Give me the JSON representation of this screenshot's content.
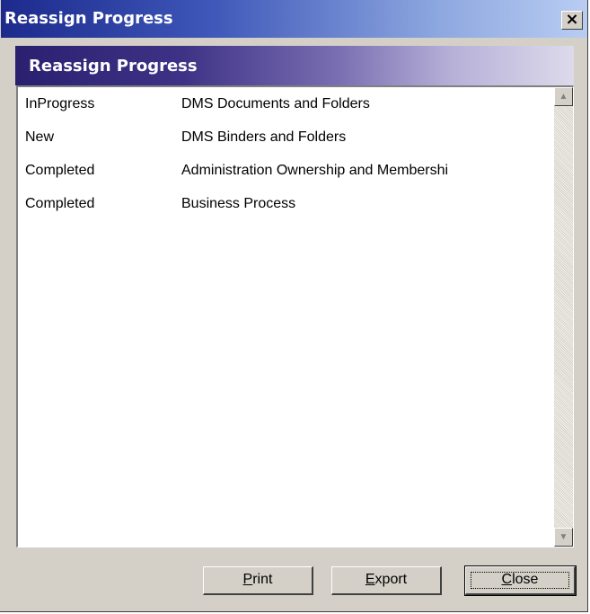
{
  "window": {
    "title": "Reassign Progress",
    "close_label": "×"
  },
  "header": {
    "title": "Reassign Progress"
  },
  "list": {
    "rows": [
      {
        "status": "InProgress",
        "name": "DMS Documents and Folders"
      },
      {
        "status": "New",
        "name": "DMS Binders and Folders"
      },
      {
        "status": "Completed",
        "name": "Administration Ownership and Membershi"
      },
      {
        "status": "Completed",
        "name": "Business Process"
      }
    ]
  },
  "scrollbar": {
    "up_arrow": "▲",
    "down_arrow": "▼"
  },
  "buttons": {
    "print": {
      "accel": "P",
      "rest": "rint"
    },
    "export": {
      "accel": "E",
      "rest": "xport"
    },
    "close": {
      "accel": "C",
      "rest": "lose"
    }
  }
}
